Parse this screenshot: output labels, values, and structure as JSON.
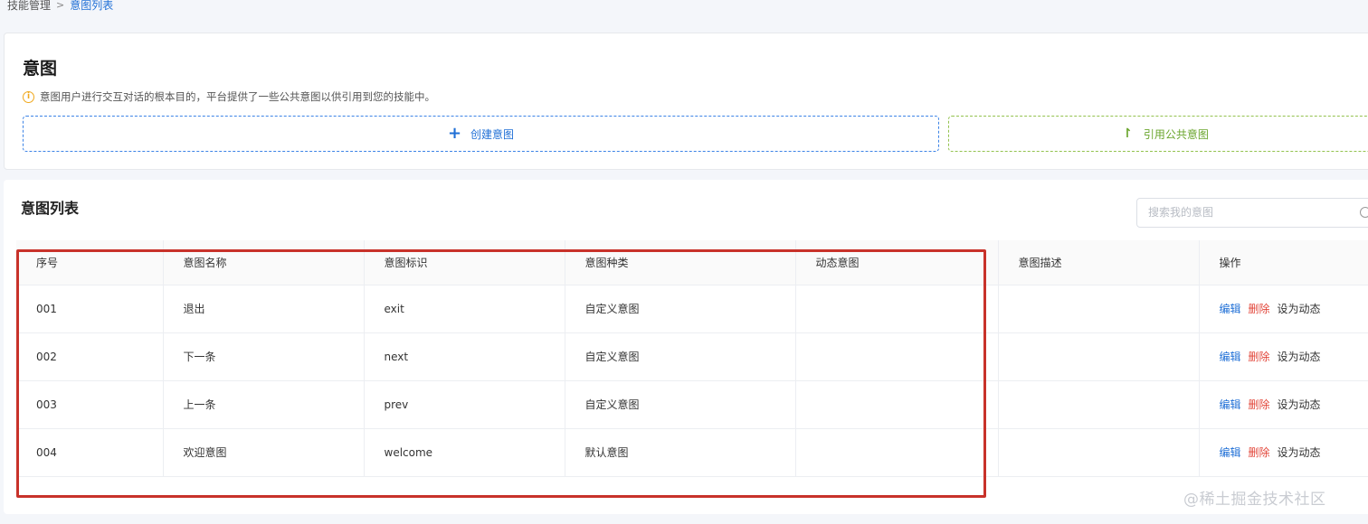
{
  "breadcrumb": {
    "root": "技能管理",
    "separator": ">",
    "current": "意图列表"
  },
  "header": {
    "title": "意图",
    "hint": "意图用户进行交互对话的根本目的，平台提供了一些公共意图以供引用到您的技能中。",
    "create_label": "创建意图",
    "reference_label": "引用公共意图"
  },
  "list": {
    "title": "意图列表",
    "search_placeholder": "搜索我的意图",
    "columns": [
      "序号",
      "意图名称",
      "意图标识",
      "意图种类",
      "动态意图",
      "意图描述",
      "操作"
    ],
    "rows": [
      {
        "no": "001",
        "name": "退出",
        "id": "exit",
        "kind": "自定义意图",
        "dynamic": "",
        "desc": ""
      },
      {
        "no": "002",
        "name": "下一条",
        "id": "next",
        "kind": "自定义意图",
        "dynamic": "",
        "desc": ""
      },
      {
        "no": "003",
        "name": "上一条",
        "id": "prev",
        "kind": "自定义意图",
        "dynamic": "",
        "desc": ""
      },
      {
        "no": "004",
        "name": "欢迎意图",
        "id": "welcome",
        "kind": "默认意图",
        "dynamic": "",
        "desc": ""
      }
    ],
    "actions": {
      "edit": "编辑",
      "delete": "删除",
      "set_dynamic": "设为动态"
    }
  },
  "watermark": "@稀土掘金技术社区",
  "colors": {
    "accent": "#1f6fd6",
    "danger": "#e2463a",
    "reference": "#6aa52d",
    "highlight": "#c8322a"
  },
  "icons": {
    "info": "info-icon",
    "plus": "plus-icon",
    "reference": "reference-icon",
    "search": "search-icon"
  }
}
